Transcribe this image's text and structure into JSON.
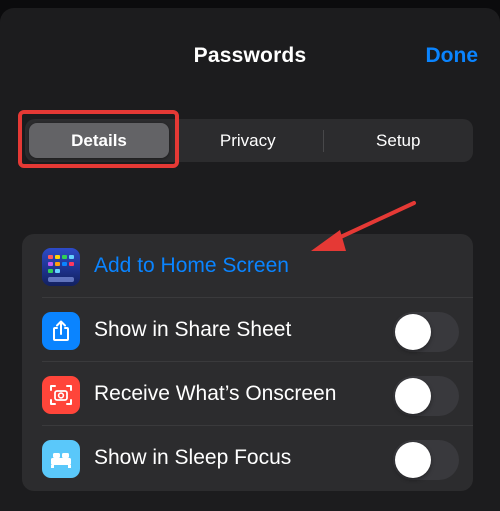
{
  "header": {
    "title": "Passwords",
    "done_label": "Done"
  },
  "segments": [
    {
      "label": "Details",
      "selected": true
    },
    {
      "label": "Privacy",
      "selected": false
    },
    {
      "label": "Setup",
      "selected": false
    }
  ],
  "rows": [
    {
      "label": "Add to Home Screen",
      "icon": "home-screen-grid-icon"
    },
    {
      "label": "Show in Share Sheet",
      "icon": "share-icon",
      "toggle_on": false
    },
    {
      "label": "Receive What’s Onscreen",
      "icon": "screenshot-camera-icon",
      "toggle_on": false
    },
    {
      "label": "Show in Sleep Focus",
      "icon": "bed-icon",
      "toggle_on": false
    }
  ],
  "colors": {
    "accent": "#0a84ff",
    "annotation": "#e53935",
    "share_icon_bg": "#0a84ff",
    "onscreen_icon_bg": "#ff453a",
    "sleep_icon_bg": "#5ac8fa"
  }
}
